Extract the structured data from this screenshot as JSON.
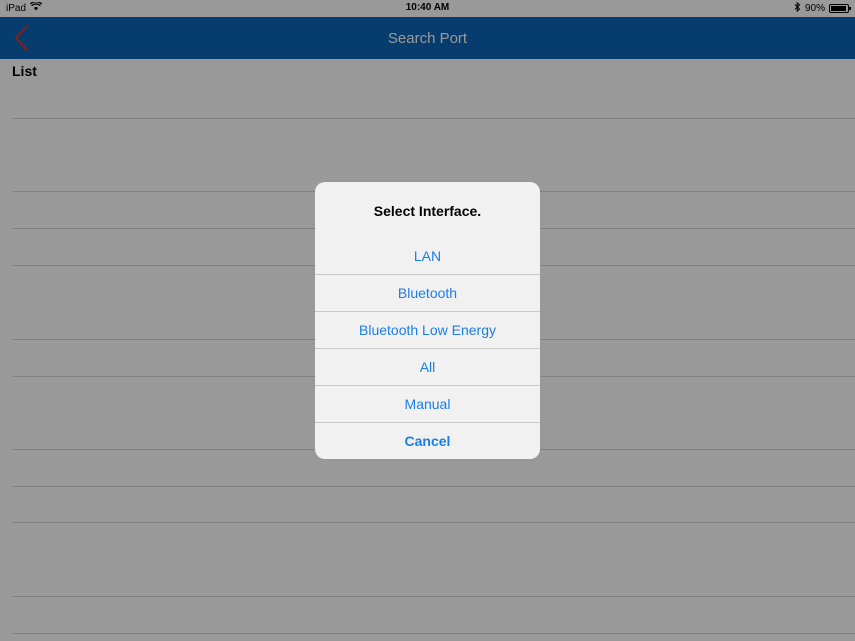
{
  "status_bar": {
    "device": "iPad",
    "time": "10:40 AM",
    "battery": "90%"
  },
  "nav": {
    "title": "Search Port",
    "back_icon": "chevron-left-icon",
    "colors": {
      "bar": "#0a64b8",
      "back": "#d03a3a"
    }
  },
  "list": {
    "header": "List"
  },
  "dialog": {
    "title": "Select Interface.",
    "options": [
      "LAN",
      "Bluetooth",
      "Bluetooth Low Energy",
      "All",
      "Manual"
    ],
    "cancel_label": "Cancel",
    "accent": "#1a7ee8"
  }
}
